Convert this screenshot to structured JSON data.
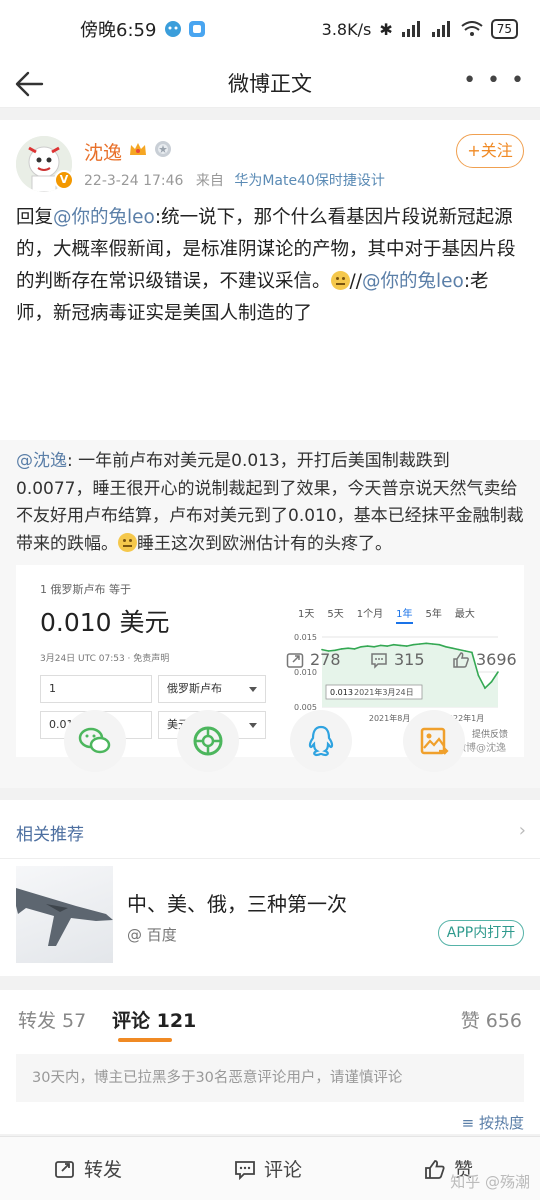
{
  "status_bar": {
    "time": "傍晚6:59",
    "speed": "3.8K/s",
    "battery": "75"
  },
  "header": {
    "title": "微博正文",
    "more_label": "• • •"
  },
  "post": {
    "username": "沈逸",
    "time": "22-3-24 17:46",
    "from_label": "来自",
    "device": "华为Mate40保时捷设计",
    "follow_label": "+关注",
    "text_parts": {
      "p1": "回复",
      "m1": "@你的兔leo",
      "p2": ":统一说下，那个什么看基因片段说新冠起源的，大概率假新闻，是标准阴谋论的产物，其中对于基因片段的判断存在常识级错误，不建议采信。",
      "p3": "//",
      "m2": "@你的兔leo",
      "p4": ":老师，新冠病毒证实是美国人制造的了"
    },
    "stats": {
      "reposts": "278",
      "comments": "315",
      "likes": "3696"
    }
  },
  "repost": {
    "mention": "@沈逸",
    "text1": ": 一年前卢布对美元是0.013，开打后美国制裁跌到0.0077，睡王很开心的说制裁起到了效果，今天普京说天然气卖给不友好用卢布结算，卢布对美元到了0.010，基本已经抹平金融制裁带来的跌幅。",
    "text2": "睡王这次到欧洲估计有的头疼了。"
  },
  "fx_widget": {
    "label": "1 俄罗斯卢布 等于",
    "value": "0.010 美元",
    "date_note": "3月24日 UTC 07:53 · 免责声明",
    "input1": "1",
    "unit1": "俄罗斯卢布",
    "input2": "0.010",
    "unit2": "美元",
    "tabs": [
      "1天",
      "5天",
      "1个月",
      "1年",
      "5年",
      "最大"
    ],
    "active_tab": "1年",
    "feedback": "提供反馈",
    "watermark": "微博@沈逸",
    "tooltip": {
      "value": "0.013",
      "date": "2021年3月24日"
    },
    "chart_data": {
      "type": "line",
      "x_ticks": [
        "2021年8月",
        "2022年1月"
      ],
      "y_ticks": [
        "0.015",
        "0.010",
        "0.005"
      ],
      "ylim": [
        0.005,
        0.015
      ],
      "series": [
        {
          "values": [
            0.0132,
            0.013,
            0.0131,
            0.0133,
            0.0134,
            0.0133,
            0.0136,
            0.0137,
            0.0136,
            0.0138,
            0.0137,
            0.0139,
            0.0138,
            0.0137,
            0.0139,
            0.014,
            0.0141,
            0.014,
            0.0139,
            0.0136,
            0.0134,
            0.0132,
            0.013,
            0.0128,
            0.0095,
            0.0077,
            0.0086,
            0.01
          ]
        }
      ],
      "color": "#34a853",
      "grid": true
    }
  },
  "related": {
    "title": "相关推荐",
    "headline": "中、美、俄，三种第一次",
    "source": "百度",
    "app_button": "APP内打开"
  },
  "tabs": {
    "repost": "转发 57",
    "comment": "评论 121",
    "like": "赞 656"
  },
  "notice": "30天内，博主已拉黑多于30名恶意评论用户，请谨慎评论",
  "sort_label": "按热度",
  "bottom_bar": {
    "repost": "转发",
    "comment": "评论",
    "like": "赞"
  },
  "zhihu_watermark": "知乎 @殇潮"
}
